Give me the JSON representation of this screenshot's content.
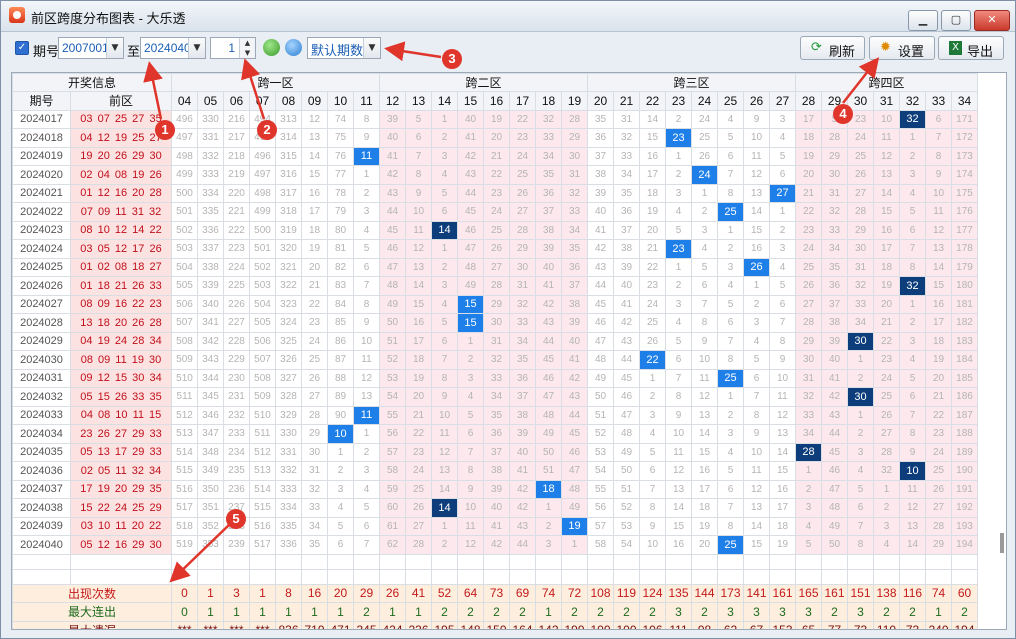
{
  "title": "前区跨度分布图表 - 大乐透",
  "toolbar": {
    "period_label": "期号",
    "from_value": "2007001",
    "to_label": "至",
    "to_value": "2024040",
    "step_value": "1",
    "mode_value": "默认期数",
    "refresh_label": "刷新",
    "settings_label": "设置",
    "export_label": "导出"
  },
  "grid": {
    "group_header": "开奖信息",
    "col_period": "期号",
    "col_front": "前区",
    "zones": [
      "跨一区",
      "跨二区",
      "跨三区",
      "跨四区"
    ],
    "spans": [
      "04",
      "05",
      "06",
      "07",
      "08",
      "09",
      "10",
      "11",
      "12",
      "13",
      "14",
      "15",
      "16",
      "17",
      "18",
      "19",
      "20",
      "21",
      "22",
      "23",
      "24",
      "25",
      "26",
      "27",
      "28",
      "29",
      "30",
      "31",
      "32",
      "33",
      "34"
    ],
    "rows": [
      {
        "period": "2024017",
        "front": "03 07 25 27 35",
        "cells": [
          496,
          330,
          216,
          494,
          313,
          12,
          74,
          8,
          39,
          5,
          1,
          40,
          19,
          22,
          32,
          28,
          35,
          31,
          14,
          2,
          24,
          4,
          9,
          3,
          17,
          5,
          23,
          10,
          32,
          6,
          171
        ],
        "hit": 28
      },
      {
        "period": "2024018",
        "front": "04 12 19 25 27",
        "cells": [
          497,
          331,
          217,
          495,
          314,
          13,
          75,
          9,
          40,
          6,
          2,
          41,
          20,
          23,
          33,
          29,
          36,
          32,
          15,
          23,
          25,
          5,
          10,
          4,
          18,
          28,
          24,
          11,
          1,
          7,
          172
        ],
        "hit": 19
      },
      {
        "period": "2024019",
        "front": "19 20 26 29 30",
        "cells": [
          498,
          332,
          218,
          496,
          315,
          14,
          76,
          11,
          41,
          7,
          3,
          42,
          21,
          24,
          34,
          30,
          37,
          33,
          16,
          1,
          26,
          6,
          11,
          5,
          19,
          29,
          25,
          12,
          2,
          8,
          173
        ],
        "hit": 7
      },
      {
        "period": "2024020",
        "front": "02 04 08 19 26",
        "cells": [
          499,
          333,
          219,
          497,
          316,
          15,
          77,
          1,
          42,
          8,
          4,
          43,
          22,
          25,
          35,
          31,
          38,
          34,
          17,
          2,
          24,
          7,
          12,
          6,
          20,
          30,
          26,
          13,
          3,
          9,
          174
        ],
        "hit": 20
      },
      {
        "period": "2024021",
        "front": "01 12 16 20 28",
        "cells": [
          500,
          334,
          220,
          498,
          317,
          16,
          78,
          2,
          43,
          9,
          5,
          44,
          23,
          26,
          36,
          32,
          39,
          35,
          18,
          3,
          1,
          8,
          13,
          27,
          21,
          31,
          27,
          14,
          4,
          10,
          175
        ],
        "hit": 23
      },
      {
        "period": "2024022",
        "front": "07 09 11 31 32",
        "cells": [
          501,
          335,
          221,
          499,
          318,
          17,
          79,
          3,
          44,
          10,
          6,
          45,
          24,
          27,
          37,
          33,
          40,
          36,
          19,
          4,
          2,
          25,
          14,
          1,
          22,
          32,
          28,
          15,
          5,
          11,
          176
        ],
        "hit": 21
      },
      {
        "period": "2024023",
        "front": "08 10 12 14 22",
        "cells": [
          502,
          336,
          222,
          500,
          319,
          18,
          80,
          4,
          45,
          11,
          14,
          46,
          25,
          28,
          38,
          34,
          41,
          37,
          20,
          5,
          3,
          1,
          15,
          2,
          23,
          33,
          29,
          16,
          6,
          12,
          177
        ],
        "hit": 10
      },
      {
        "period": "2024024",
        "front": "03 05 12 17 26",
        "cells": [
          503,
          337,
          223,
          501,
          320,
          19,
          81,
          5,
          46,
          12,
          1,
          47,
          26,
          29,
          39,
          35,
          42,
          38,
          21,
          23,
          4,
          2,
          16,
          3,
          24,
          34,
          30,
          17,
          7,
          13,
          178
        ],
        "hit": 19
      },
      {
        "period": "2024025",
        "front": "01 02 08 18 27",
        "cells": [
          504,
          338,
          224,
          502,
          321,
          20,
          82,
          6,
          47,
          13,
          2,
          48,
          27,
          30,
          40,
          36,
          43,
          39,
          22,
          1,
          5,
          3,
          26,
          4,
          25,
          35,
          31,
          18,
          8,
          14,
          179
        ],
        "hit": 22
      },
      {
        "period": "2024026",
        "front": "01 18 21 26 33",
        "cells": [
          505,
          339,
          225,
          503,
          322,
          21,
          83,
          7,
          48,
          14,
          3,
          49,
          28,
          31,
          41,
          37,
          44,
          40,
          23,
          2,
          6,
          4,
          1,
          5,
          26,
          36,
          32,
          19,
          32,
          15,
          180
        ],
        "hit": 28
      },
      {
        "period": "2024027",
        "front": "08 09 16 22 23",
        "cells": [
          506,
          340,
          226,
          504,
          323,
          22,
          84,
          8,
          49,
          15,
          4,
          15,
          29,
          32,
          42,
          38,
          45,
          41,
          24,
          3,
          7,
          5,
          2,
          6,
          27,
          37,
          33,
          20,
          1,
          16,
          181
        ],
        "hit": 11
      },
      {
        "period": "2024028",
        "front": "13 18 20 26 28",
        "cells": [
          507,
          341,
          227,
          505,
          324,
          23,
          85,
          9,
          50,
          16,
          5,
          15,
          30,
          33,
          43,
          39,
          46,
          42,
          25,
          4,
          8,
          6,
          3,
          7,
          28,
          38,
          34,
          21,
          2,
          17,
          182
        ],
        "hit": 11
      },
      {
        "period": "2024029",
        "front": "04 19 24 28 34",
        "cells": [
          508,
          342,
          228,
          506,
          325,
          24,
          86,
          10,
          51,
          17,
          6,
          1,
          31,
          34,
          44,
          40,
          47,
          43,
          26,
          5,
          9,
          7,
          4,
          8,
          29,
          39,
          30,
          22,
          3,
          18,
          183
        ],
        "hit": 26
      },
      {
        "period": "2024030",
        "front": "08 09 11 19 30",
        "cells": [
          509,
          343,
          229,
          507,
          326,
          25,
          87,
          11,
          52,
          18,
          7,
          2,
          32,
          35,
          45,
          41,
          48,
          44,
          22,
          6,
          10,
          8,
          5,
          9,
          30,
          40,
          1,
          23,
          4,
          19,
          184
        ],
        "hit": 18
      },
      {
        "period": "2024031",
        "front": "09 12 15 30 34",
        "cells": [
          510,
          344,
          230,
          508,
          327,
          26,
          88,
          12,
          53,
          19,
          8,
          3,
          33,
          36,
          46,
          42,
          49,
          45,
          1,
          7,
          11,
          25,
          6,
          10,
          31,
          41,
          2,
          24,
          5,
          20,
          185
        ],
        "hit": 21
      },
      {
        "period": "2024032",
        "front": "05 15 26 33 35",
        "cells": [
          511,
          345,
          231,
          509,
          328,
          27,
          89,
          13,
          54,
          20,
          9,
          4,
          34,
          37,
          47,
          43,
          50,
          46,
          2,
          8,
          12,
          1,
          7,
          11,
          32,
          42,
          30,
          25,
          6,
          21,
          186
        ],
        "hit": 26
      },
      {
        "period": "2024033",
        "front": "04 08 10 11 15",
        "cells": [
          512,
          346,
          232,
          510,
          329,
          28,
          90,
          11,
          55,
          21,
          10,
          5,
          35,
          38,
          48,
          44,
          51,
          47,
          3,
          9,
          13,
          2,
          8,
          12,
          33,
          43,
          1,
          26,
          7,
          22,
          187
        ],
        "hit": 7
      },
      {
        "period": "2024034",
        "front": "23 26 27 29 33",
        "cells": [
          513,
          347,
          233,
          511,
          330,
          29,
          10,
          1,
          56,
          22,
          11,
          6,
          36,
          39,
          49,
          45,
          52,
          48,
          4,
          10,
          14,
          3,
          9,
          13,
          34,
          44,
          2,
          27,
          8,
          23,
          188
        ],
        "hit": 6
      },
      {
        "period": "2024035",
        "front": "05 13 17 29 33",
        "cells": [
          514,
          348,
          234,
          512,
          331,
          30,
          1,
          2,
          57,
          23,
          12,
          7,
          37,
          40,
          50,
          46,
          53,
          49,
          5,
          11,
          15,
          4,
          10,
          14,
          28,
          45,
          3,
          28,
          9,
          24,
          189
        ],
        "hit": 24
      },
      {
        "period": "2024036",
        "front": "02 05 11 32 34",
        "cells": [
          515,
          349,
          235,
          513,
          332,
          31,
          2,
          3,
          58,
          24,
          13,
          8,
          38,
          41,
          51,
          47,
          54,
          50,
          6,
          12,
          16,
          5,
          11,
          15,
          1,
          46,
          4,
          32,
          10,
          25,
          190
        ],
        "hit": 28
      },
      {
        "period": "2024037",
        "front": "17 19 20 29 35",
        "cells": [
          516,
          350,
          236,
          514,
          333,
          32,
          3,
          4,
          59,
          25,
          14,
          9,
          39,
          42,
          18,
          48,
          55,
          51,
          7,
          13,
          17,
          6,
          12,
          16,
          2,
          47,
          5,
          1,
          11,
          26,
          191
        ],
        "hit": 14
      },
      {
        "period": "2024038",
        "front": "15 22 24 25 29",
        "cells": [
          517,
          351,
          237,
          515,
          334,
          33,
          4,
          5,
          60,
          26,
          14,
          10,
          40,
          42,
          1,
          49,
          56,
          52,
          8,
          14,
          18,
          7,
          13,
          17,
          3,
          48,
          6,
          2,
          12,
          27,
          192
        ],
        "hit": 10
      },
      {
        "period": "2024039",
        "front": "03 10 11 20 22",
        "cells": [
          518,
          352,
          238,
          516,
          335,
          34,
          5,
          6,
          61,
          27,
          1,
          11,
          41,
          43,
          2,
          19,
          57,
          53,
          9,
          15,
          19,
          8,
          14,
          18,
          4,
          49,
          7,
          3,
          13,
          28,
          193
        ],
        "hit": 15
      },
      {
        "period": "2024040",
        "front": "05 12 16 29 30",
        "cells": [
          519,
          353,
          239,
          517,
          336,
          35,
          6,
          7,
          62,
          28,
          2,
          12,
          42,
          44,
          3,
          1,
          58,
          54,
          10,
          16,
          20,
          25,
          15,
          19,
          5,
          50,
          8,
          4,
          14,
          29,
          194
        ],
        "hit": 21
      }
    ],
    "stats": [
      {
        "label": "出现次数",
        "values": [
          "0",
          "1",
          "3",
          "1",
          "8",
          "16",
          "20",
          "29",
          "26",
          "41",
          "52",
          "64",
          "73",
          "69",
          "74",
          "72",
          "108",
          "119",
          "124",
          "135",
          "144",
          "173",
          "141",
          "161",
          "165",
          "161",
          "151",
          "138",
          "116",
          "74",
          "60"
        ]
      },
      {
        "label": "最大连出",
        "values": [
          "0",
          "1",
          "1",
          "1",
          "1",
          "1",
          "1",
          "2",
          "1",
          "1",
          "2",
          "2",
          "2",
          "2",
          "1",
          "2",
          "2",
          "2",
          "2",
          "3",
          "2",
          "3",
          "3",
          "3",
          "3",
          "2",
          "3",
          "2",
          "2",
          "1",
          "2"
        ]
      },
      {
        "label": "最大遗漏",
        "values": [
          "***",
          "***",
          "***",
          "***",
          "836",
          "719",
          "471",
          "345",
          "424",
          "236",
          "195",
          "148",
          "150",
          "164",
          "142",
          "199",
          "100",
          "100",
          "106",
          "111",
          "98",
          "62",
          "67",
          "153",
          "65",
          "77",
          "73",
          "110",
          "73",
          "240",
          "194"
        ]
      }
    ]
  },
  "colors": {
    "hit_light": "#1e7fe8",
    "hit_dark": "#0d3d7a",
    "front_bg": "#fde2e2",
    "front_text": "#c0101b",
    "zone_pink": "#fde8ee",
    "stat_bg": "#fdeede"
  },
  "annotations": [
    "1",
    "2",
    "3",
    "4",
    "5"
  ]
}
